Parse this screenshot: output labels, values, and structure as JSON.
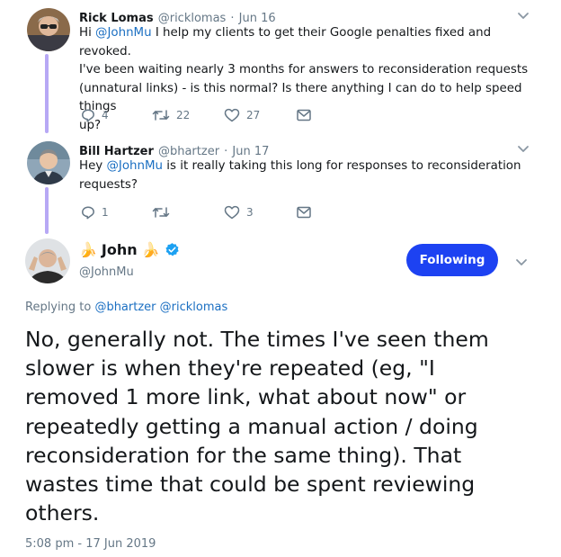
{
  "tweets": [
    {
      "display_name": "Rick Lomas",
      "handle": "@ricklomas",
      "date": "Jun 16",
      "body_lines": [
        [
          "Hi ",
          "@JohnMu",
          " I help my clients to get their Google penalties fixed and revoked."
        ],
        [
          "I've been waiting nearly 3 months for answers to reconsideration requests"
        ],
        [
          "(unnatural links) - is this normal? Is there anything I can do to help speed things"
        ],
        [
          "up?"
        ]
      ],
      "replies": "4",
      "retweets": "22",
      "likes": "27"
    },
    {
      "display_name": "Bill Hartzer",
      "handle": "@bhartzer",
      "date": "Jun 17",
      "body_lines": [
        [
          "Hey ",
          "@JohnMu",
          " is it really taking this long for responses to reconsideration"
        ],
        [
          "requests?"
        ]
      ],
      "replies": "1",
      "retweets": "",
      "likes": "3"
    }
  ],
  "main_tweet": {
    "display_name": "John",
    "name_emoji": "🍌",
    "handle": "@JohnMu",
    "follow_label": "Following",
    "replying_prefix": "Replying to",
    "replying_to": [
      "@bhartzer",
      "@ricklomas"
    ],
    "body": "No, generally not. The times I've seen them slower is when they're repeated (eg, \"I removed 1 more link, what about now\" or repeatedly getting a manual action / doing reconsideration for the same thing). That wastes time that could be spent reviewing others.",
    "timestamp": "5:08 pm - 17 Jun 2019"
  },
  "colors": {
    "follow_button": "#1d42f2",
    "mention": "#1b6fc2",
    "thread_line": "#b7a8f5",
    "verified": "#1da1f2"
  }
}
